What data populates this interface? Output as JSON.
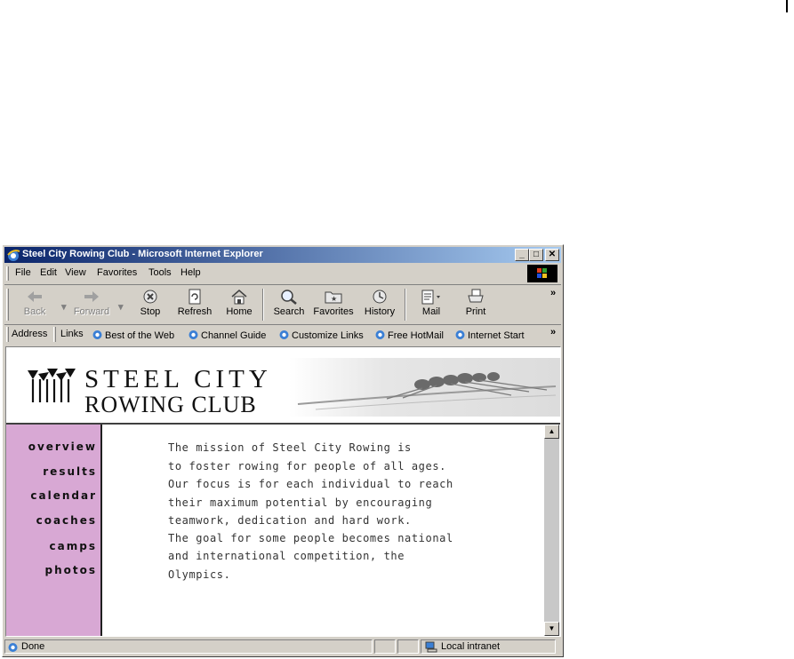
{
  "window": {
    "title": "Steel City Rowing Club - Microsoft Internet Explorer",
    "min_label": "_",
    "max_label": "□",
    "close_label": "✕"
  },
  "menu": {
    "items": [
      {
        "label": "File"
      },
      {
        "label": "Edit"
      },
      {
        "label": "View"
      },
      {
        "label": "Favorites"
      },
      {
        "label": "Tools"
      },
      {
        "label": "Help"
      }
    ]
  },
  "toolbar": {
    "back": "Back",
    "forward": "Forward",
    "stop": "Stop",
    "refresh": "Refresh",
    "home": "Home",
    "search": "Search",
    "favorites": "Favorites",
    "history": "History",
    "mail": "Mail",
    "print": "Print",
    "more": "»"
  },
  "addressbar": {
    "address_label": "Address",
    "links_label": "Links",
    "links": [
      {
        "label": "Best of the Web"
      },
      {
        "label": "Channel Guide"
      },
      {
        "label": "Customize Links"
      },
      {
        "label": "Free HotMail"
      },
      {
        "label": "Internet Start"
      }
    ],
    "more": "»"
  },
  "site": {
    "logo_line1": "STEEL CITY",
    "logo_line2": "ROWING CLUB",
    "nav": [
      {
        "label": "overview"
      },
      {
        "label": "results"
      },
      {
        "label": "calendar"
      },
      {
        "label": "coaches"
      },
      {
        "label": "camps"
      },
      {
        "label": "photos"
      }
    ],
    "mission_lines": [
      "The mission of Steel City Rowing is",
      "to foster rowing for people of all ages.",
      "Our focus is for each individual to reach",
      "their maximum potential by encouraging",
      "teamwork, dedication and hard work.",
      "The goal for some people becomes national",
      "and international competition, the",
      "Olympics."
    ]
  },
  "status": {
    "text": "Done",
    "zone": "Local intranet"
  },
  "colors": {
    "titlebar_start": "#0a246a",
    "titlebar_end": "#a6caf0",
    "nav_background": "#d8a8d4",
    "chrome": "#d4d0c8"
  }
}
